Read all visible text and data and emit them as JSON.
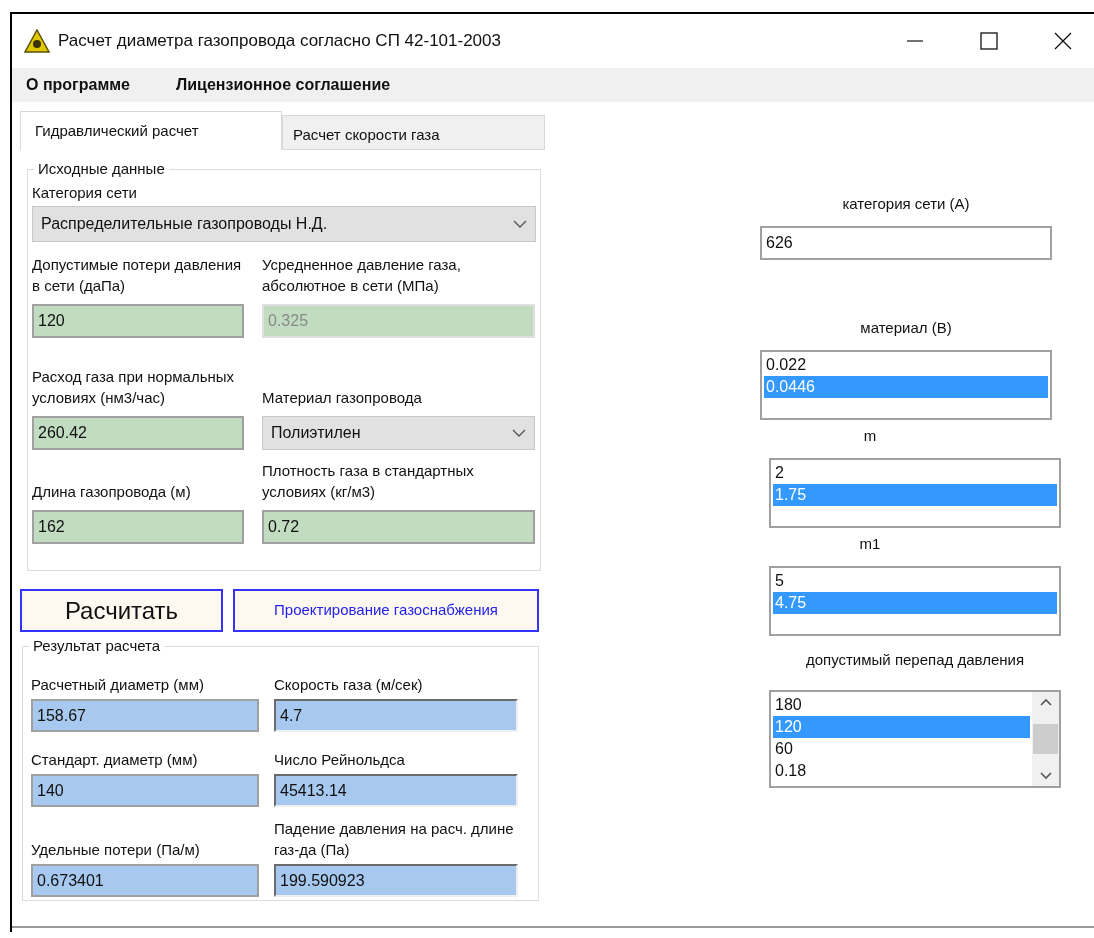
{
  "window": {
    "title": "Расчет диаметра газопровода согласно СП 42-101-2003"
  },
  "menu": [
    "О программе",
    "Лицензионное соглашение"
  ],
  "tabs": [
    {
      "label": "Гидравлический расчет",
      "selected": true
    },
    {
      "label": "Расчет скорости газа",
      "selected": false
    }
  ],
  "input_group": {
    "title": "Исходные данные",
    "category": {
      "label": "Категория сети",
      "value": "Распределительные газопроводы Н.Д."
    },
    "rows": [
      [
        {
          "kind": "input",
          "label": "Допустимые потери давления в сети  (даПа)",
          "value": "120",
          "disabled": false
        },
        {
          "kind": "input",
          "label": "Усредненное давление газа, абсолютное в сети (МПа)",
          "value": "0.325",
          "disabled": true
        }
      ],
      [
        {
          "kind": "input",
          "label": "Расход газа при нормальных условиях (нм3/час)",
          "value": "260.42",
          "disabled": false
        },
        {
          "kind": "select",
          "label": "Материал газопровода",
          "value": "Полиэтилен"
        }
      ],
      [
        {
          "kind": "input",
          "label": "Длина газопровода (м)",
          "value": "162",
          "disabled": false
        },
        {
          "kind": "input",
          "label": "Плотность газа в стандартных условиях (кг/м3)",
          "value": "0.72",
          "disabled": false
        }
      ]
    ]
  },
  "buttons": {
    "calculate": "Расчитать",
    "design": "Проектирование газоснабжения"
  },
  "result_group": {
    "title": "Результат расчета",
    "rows": [
      [
        {
          "label": "Расчетный диаметр (мм)",
          "value": "158.67"
        },
        {
          "label": "Скорость газа (м/сек)",
          "value": "4.7"
        }
      ],
      [
        {
          "label": "Стандарт. диаметр (мм)",
          "value": "140"
        },
        {
          "label": "Число Рейнольдса",
          "value": "45413.14"
        }
      ],
      [
        {
          "label": "Удельные потери (Па/м)",
          "value": "0.673401"
        },
        {
          "label": "Падение давления на расч. длине газ-да (Па)",
          "value": "199.590923"
        }
      ]
    ]
  },
  "parameters": [
    {
      "kind": "input",
      "label": "категория сети (А)",
      "value": "626"
    },
    {
      "kind": "list",
      "label": "материал (В)",
      "items": [
        {
          "text": "0.022",
          "selected": false
        },
        {
          "text": "0.0446",
          "selected": true
        }
      ]
    },
    {
      "kind": "list",
      "label": "m",
      "items": [
        {
          "text": "2",
          "selected": false
        },
        {
          "text": "1.75",
          "selected": true
        }
      ]
    },
    {
      "kind": "list",
      "label": "m1",
      "items": [
        {
          "text": "5",
          "selected": false
        },
        {
          "text": "4.75",
          "selected": true
        }
      ]
    },
    {
      "kind": "scroll_list",
      "label": "допустимый перепад давления",
      "items": [
        {
          "text": "180",
          "selected": false
        },
        {
          "text": "120",
          "selected": true
        },
        {
          "text": "60",
          "selected": false
        },
        {
          "text": "0.18",
          "selected": false
        }
      ]
    }
  ]
}
